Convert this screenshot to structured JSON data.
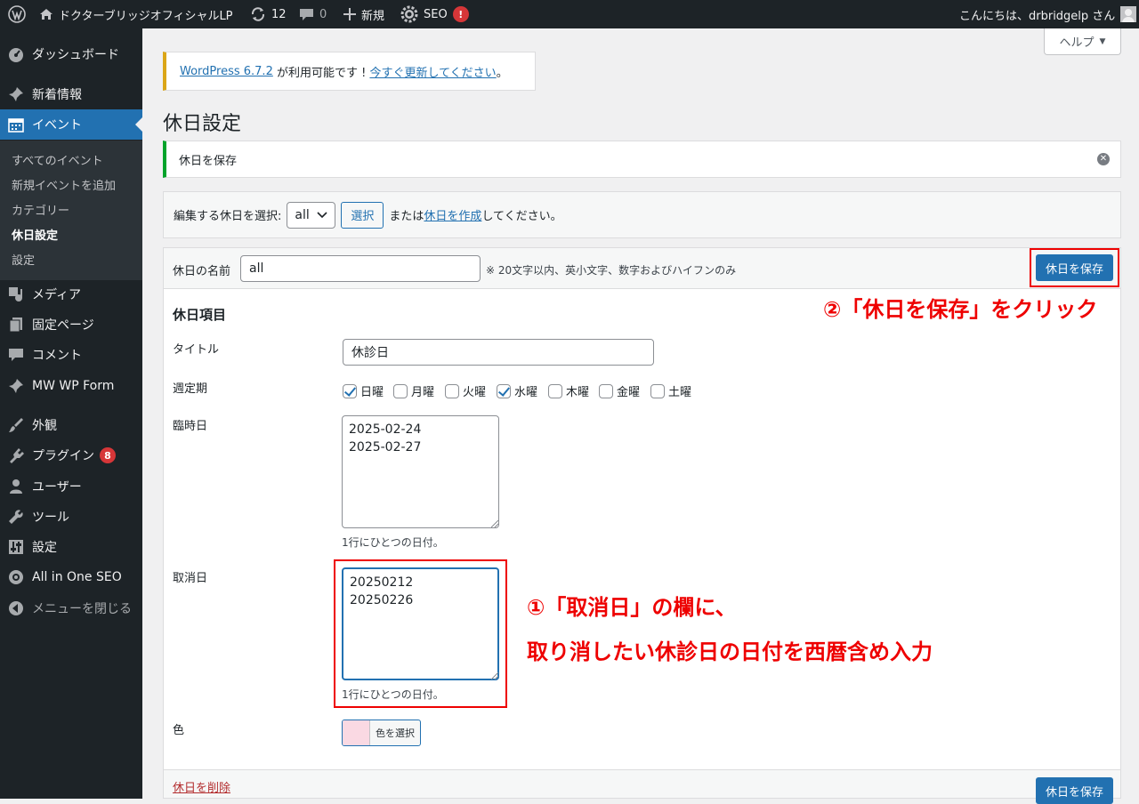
{
  "adminbar": {
    "site_name": "ドクターブリッジオフィシャルLP",
    "updates_count": "12",
    "comments_count": "0",
    "new_label": "新規",
    "seo_label": "SEO",
    "seo_badge": "!",
    "greeting": "こんにちは、drbridgelp さん"
  },
  "sidebar": {
    "items": [
      {
        "label": "ダッシュボード",
        "icon": "dashboard-icon"
      },
      {
        "label": "新着情報",
        "icon": "pin-icon"
      },
      {
        "label": "イベント",
        "icon": "calendar-icon"
      },
      {
        "label": "メディア",
        "icon": "media-icon"
      },
      {
        "label": "固定ページ",
        "icon": "page-icon"
      },
      {
        "label": "コメント",
        "icon": "comment-icon"
      },
      {
        "label": "MW WP Form",
        "icon": "pin-icon"
      },
      {
        "label": "外観",
        "icon": "brush-icon"
      },
      {
        "label": "プラグイン",
        "icon": "plugin-icon",
        "badge": "8"
      },
      {
        "label": "ユーザー",
        "icon": "user-icon"
      },
      {
        "label": "ツール",
        "icon": "wrench-icon"
      },
      {
        "label": "設定",
        "icon": "settings-icon"
      },
      {
        "label": "All in One SEO",
        "icon": "seo-icon"
      },
      {
        "label": "メニューを閉じる",
        "icon": "collapse-icon"
      }
    ],
    "submenu": [
      "すべてのイベント",
      "新規イベントを追加",
      "カテゴリー",
      "休日設定",
      "設定"
    ]
  },
  "help_tab": "ヘルプ",
  "update_notice": {
    "version_link": "WordPress 6.7.2",
    "middle": " が利用可能です ! ",
    "update_link": "今すぐ更新してください",
    "end": "。"
  },
  "page_title": "休日設定",
  "success_notice": "休日を保存",
  "select_row": {
    "label": "編集する休日を選択:",
    "selected": "all",
    "select_button": "選択",
    "or_text": "または",
    "create_link": "休日を作成",
    "suffix": "してください。"
  },
  "form": {
    "name_label": "休日の名前",
    "name_value": "all",
    "name_hint": "※ 20文字以内、英小文字、数字およびハイフンのみ",
    "save_label": "休日を保存",
    "section_title": "休日項目",
    "title_label": "タイトル",
    "title_value": "休診日",
    "weekly_label": "週定期",
    "days": [
      {
        "label": "日曜",
        "checked": true
      },
      {
        "label": "月曜",
        "checked": false
      },
      {
        "label": "火曜",
        "checked": false
      },
      {
        "label": "水曜",
        "checked": true
      },
      {
        "label": "木曜",
        "checked": false
      },
      {
        "label": "金曜",
        "checked": false
      },
      {
        "label": "土曜",
        "checked": false
      }
    ],
    "temp_label": "臨時日",
    "temp_value": "2025-02-24\n2025-02-27",
    "temp_hint": "1行にひとつの日付。",
    "cancel_label": "取消日",
    "cancel_value": "20250212\n20250226",
    "cancel_hint": "1行にひとつの日付。",
    "color_label": "色",
    "color_button": "色を選択",
    "color_value": "#fad9e3",
    "delete_link": "休日を削除",
    "save_label_bottom": "休日を保存"
  },
  "annotations": {
    "step2": "②「休日を保存」をクリック",
    "step1_line1": "①「取消日」の欄に、",
    "step1_line2": "取り消したい休診日の日付を西暦含め入力",
    "color": "#ee0000"
  }
}
